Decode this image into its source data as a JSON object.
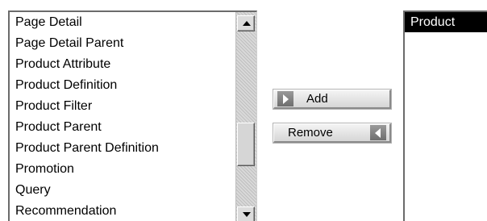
{
  "available_list": {
    "items": [
      "Page Detail",
      "Page Detail Parent",
      "Product Attribute",
      "Product Definition",
      "Product Filter",
      "Product Parent",
      "Product Parent Definition",
      "Promotion",
      "Query",
      "Recommendation"
    ]
  },
  "buttons": {
    "add_label": "Add",
    "remove_label": "Remove"
  },
  "selected_list": {
    "items": [
      "Product"
    ],
    "highlighted": "Product"
  },
  "icons": {
    "scroll_up": "triangle-up-icon",
    "scroll_down": "triangle-down-icon",
    "add": "arrow-right-icon",
    "remove": "arrow-left-icon"
  },
  "colors": {
    "selection_background": "#000000",
    "selection_text": "#ffffff"
  }
}
